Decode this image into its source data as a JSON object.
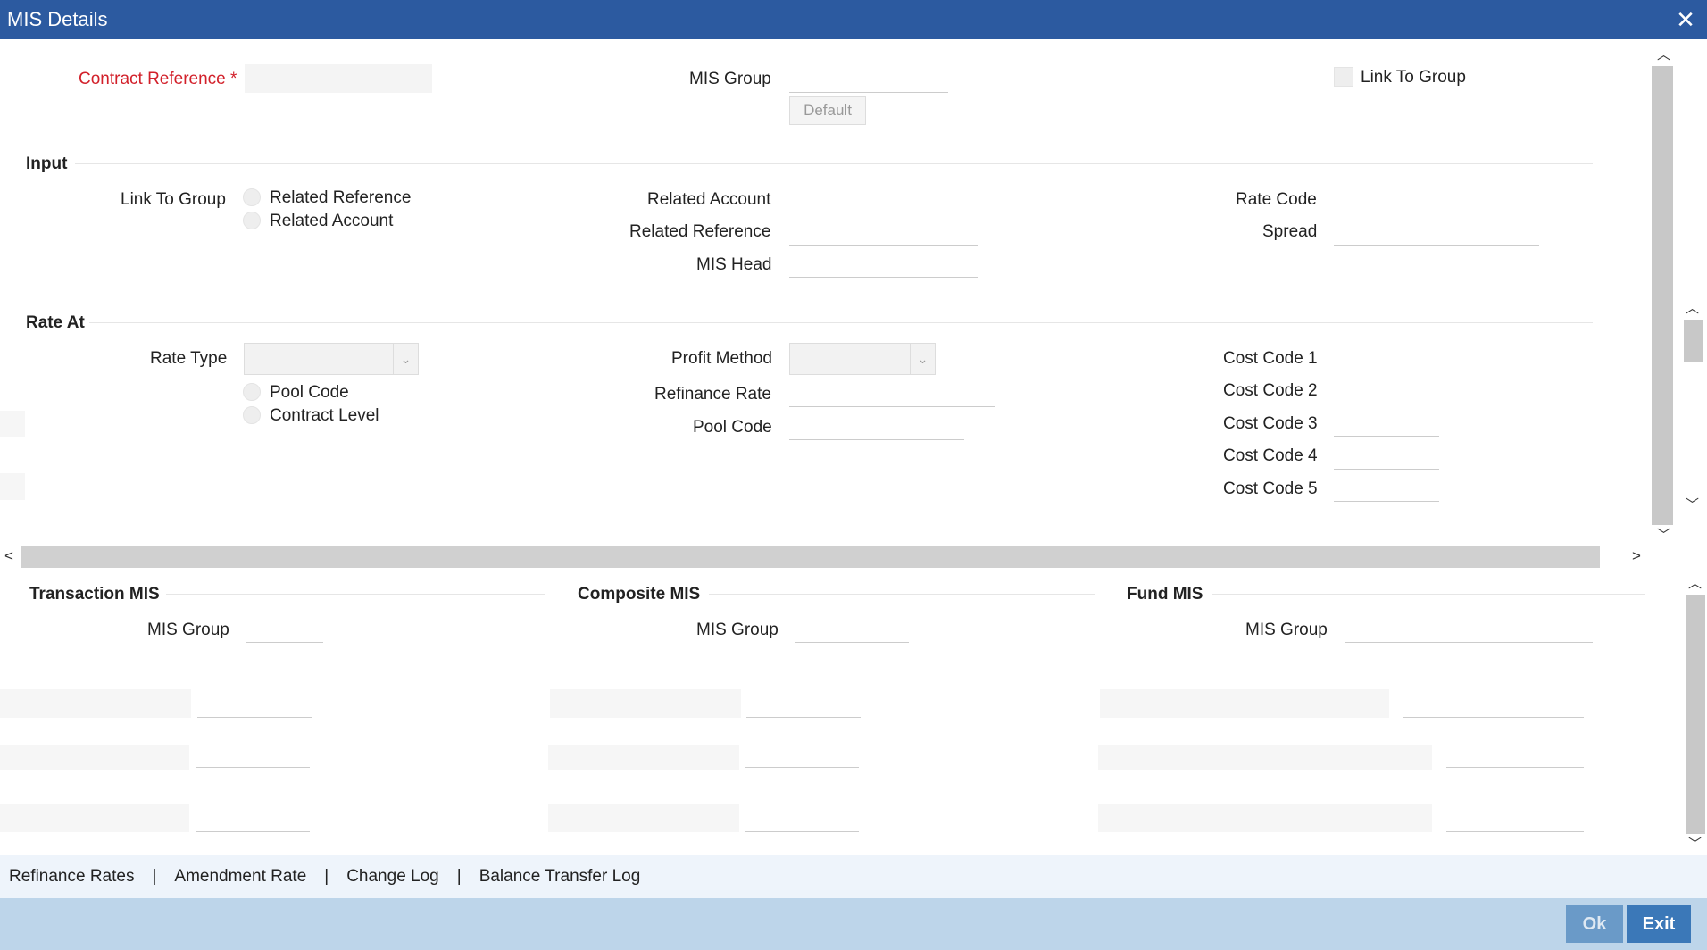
{
  "window": {
    "title": "MIS Details",
    "close_glyph": "✕"
  },
  "header": {
    "contract_reference_label": "Contract Reference",
    "required_mark": "*",
    "mis_group_label": "MIS Group",
    "default_button": "Default",
    "link_to_group_label": "Link To Group"
  },
  "input_section": {
    "title": "Input",
    "link_to_group_label": "Link To Group",
    "radio_related_reference": "Related Reference",
    "radio_related_account": "Related Account",
    "related_account_label": "Related Account",
    "related_reference_label": "Related Reference",
    "mis_head_label": "MIS Head",
    "rate_code_label": "Rate Code",
    "spread_label": "Spread"
  },
  "rate_at_section": {
    "title": "Rate At",
    "rate_type_label": "Rate Type",
    "radio_pool_code": "Pool Code",
    "radio_contract_level": "Contract Level",
    "profit_method_label": "Profit Method",
    "refinance_rate_label": "Refinance Rate",
    "pool_code_label": "Pool Code",
    "cost_codes": [
      "Cost Code 1",
      "Cost Code 2",
      "Cost Code 3",
      "Cost Code 4",
      "Cost Code 5"
    ]
  },
  "panels": {
    "transaction": {
      "title": "Transaction MIS",
      "mis_group_label": "MIS Group"
    },
    "composite": {
      "title": "Composite MIS",
      "mis_group_label": "MIS Group"
    },
    "fund": {
      "title": "Fund MIS",
      "mis_group_label": "MIS Group"
    }
  },
  "footer_links": {
    "refinance_rates": "Refinance Rates",
    "amendment_rate": "Amendment Rate",
    "change_log": "Change Log",
    "balance_transfer_log": "Balance Transfer Log",
    "separator": "|"
  },
  "actions": {
    "ok": "Ok",
    "exit": "Exit"
  },
  "scroll_glyphs": {
    "up": "︿",
    "down": "﹀",
    "left": "<",
    "right": ">"
  }
}
